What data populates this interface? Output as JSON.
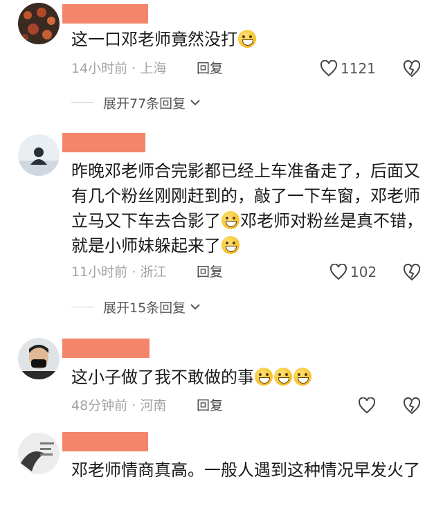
{
  "comments": [
    {
      "text": "这一口邓老师竟然没打",
      "time": "14小时前",
      "location": "上海",
      "reply_label": "回复",
      "likes": "1121",
      "expand_label": "展开77条回复"
    },
    {
      "text_part1": "昨晚邓老师合完影都已经上车准备走了，后面又有几个粉丝刚刚赶到的，敲了一下车窗，邓老师立马又下车去合影了",
      "text_part2": "邓老师对粉丝是真不错，就是小师妹躲起来了",
      "time": "11小时前",
      "location": "浙江",
      "reply_label": "回复",
      "likes": "102",
      "expand_label": "展开15条回复"
    },
    {
      "text": "这小子做了我不敢做的事",
      "time": "48分钟前",
      "location": "河南",
      "reply_label": "回复",
      "likes": ""
    },
    {
      "text": "邓老师情商真高。一般人遇到这种情况早发火了"
    }
  ],
  "separator": " · ",
  "colors": {
    "redact": "#f4846a",
    "meta": "#a3a3a3"
  }
}
